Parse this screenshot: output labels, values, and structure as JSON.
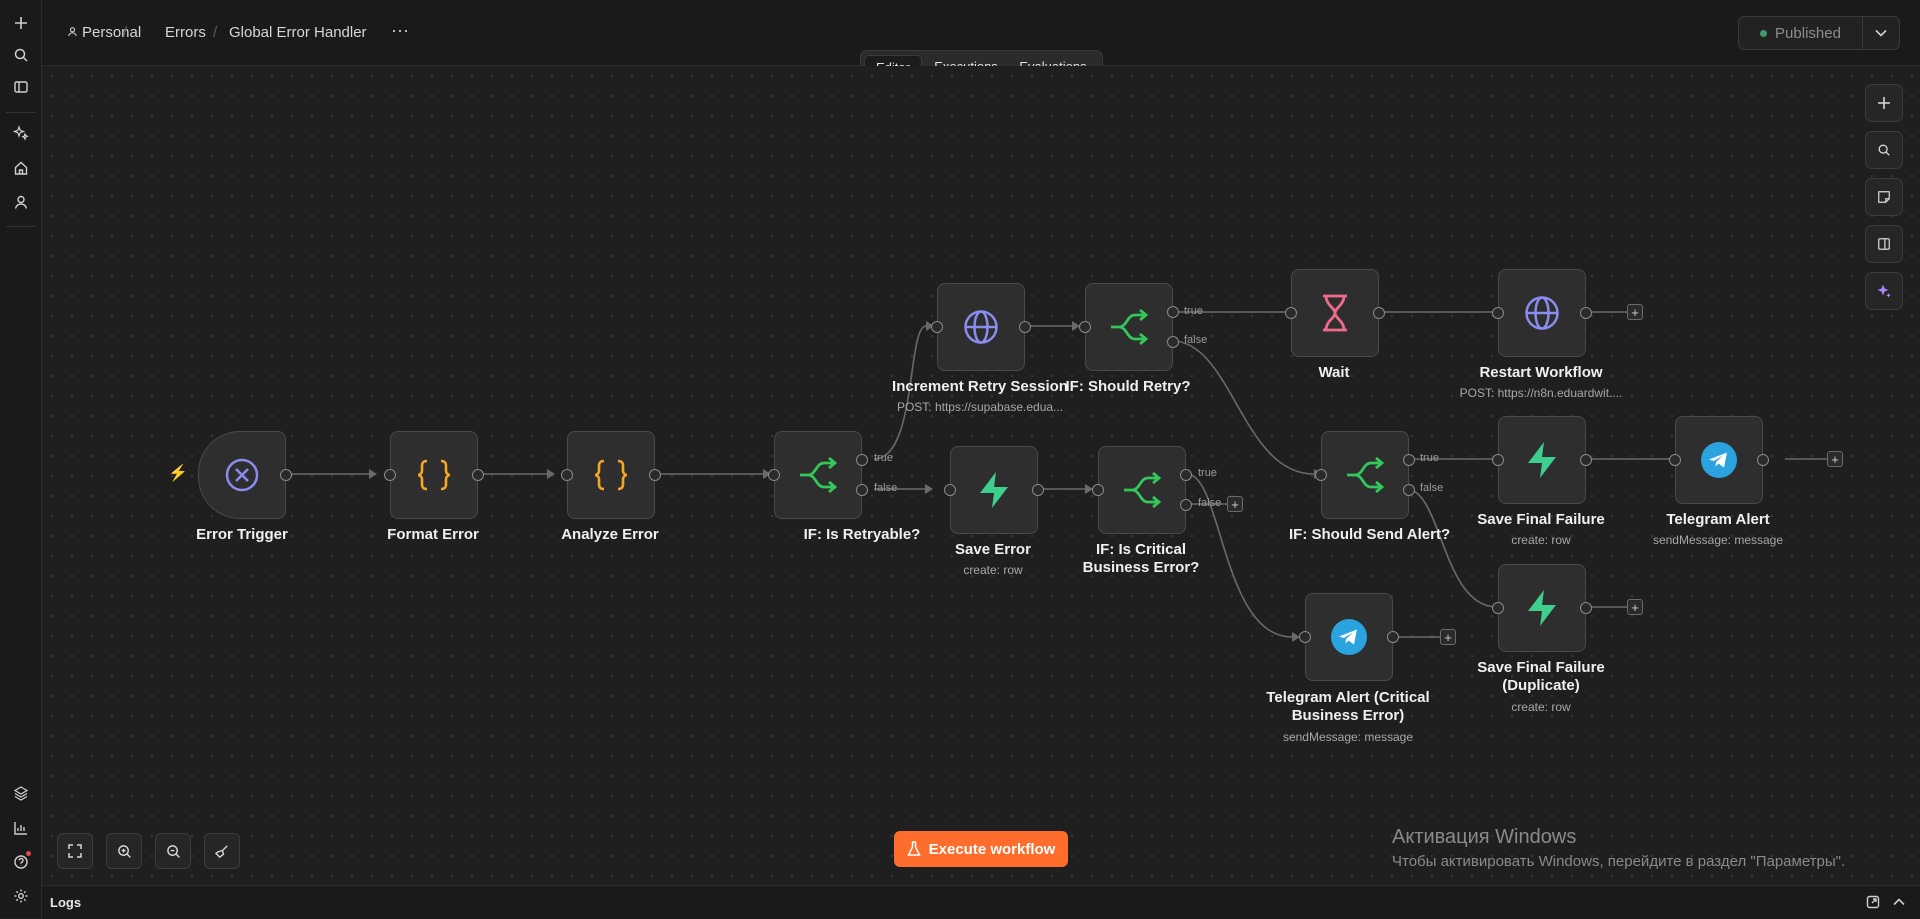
{
  "breadcrumb": {
    "project": "Personal",
    "folder": "Errors",
    "workflow": "Global Error Handler"
  },
  "header": {
    "more_label": "···",
    "publish_label": "Published"
  },
  "tabs": [
    {
      "label": "Editor",
      "active": true
    },
    {
      "label": "Executions",
      "active": false
    },
    {
      "label": "Evaluations",
      "active": false
    }
  ],
  "nodes": {
    "error_trigger": {
      "title": "Error Trigger",
      "icon": "x-circle-icon"
    },
    "format_error": {
      "title": "Format Error",
      "icon": "code-braces-icon"
    },
    "analyze_error": {
      "title": "Analyze Error",
      "icon": "code-braces-icon"
    },
    "if_retryable": {
      "title": "IF: Is Retryable?",
      "icon": "if-branch-icon"
    },
    "increment_retry": {
      "title": "Increment Retry Session",
      "subtitle": "POST: https://supabase.edua...",
      "icon": "globe-icon"
    },
    "if_should_retry": {
      "title": "IF: Should Retry?",
      "icon": "if-branch-icon"
    },
    "wait": {
      "title": "Wait",
      "icon": "hourglass-icon"
    },
    "restart_workflow": {
      "title": "Restart Workflow",
      "subtitle": "POST: https://n8n.eduardwit....",
      "icon": "globe-icon"
    },
    "save_error": {
      "title": "Save Error",
      "subtitle": "create: row",
      "icon": "supabase-icon"
    },
    "if_critical": {
      "title": "IF: Is Critical Business Error?",
      "icon": "if-branch-icon"
    },
    "if_send_alert": {
      "title": "IF: Should Send Alert?",
      "icon": "if-branch-icon"
    },
    "save_final_failure": {
      "title": "Save Final Failure",
      "subtitle": "create: row",
      "icon": "supabase-icon"
    },
    "telegram_alert": {
      "title": "Telegram Alert",
      "subtitle": "sendMessage: message",
      "icon": "telegram-icon"
    },
    "save_final_failure_dup": {
      "title": "Save Final Failure (Duplicate)",
      "subtitle": "create: row",
      "icon": "supabase-icon"
    },
    "telegram_critical": {
      "title": "Telegram Alert (Critical Business Error)",
      "subtitle": "sendMessage: message",
      "icon": "telegram-icon"
    }
  },
  "branch_labels": {
    "true": "true",
    "false": "false"
  },
  "execute_label": "Execute workflow",
  "watermark": {
    "title": "Активация Windows",
    "subtitle": "Чтобы активировать Windows, перейдите в раздел \"Параметры\"."
  },
  "logs_label": "Logs",
  "colors": {
    "accent": "#ff6d2d",
    "if_green": "#34c759",
    "supabase": "#3ecf8e",
    "globe": "#8b8cf0",
    "braces": "#f5a623",
    "telegram": "#2aa3df",
    "wait": "#f06a8a"
  }
}
